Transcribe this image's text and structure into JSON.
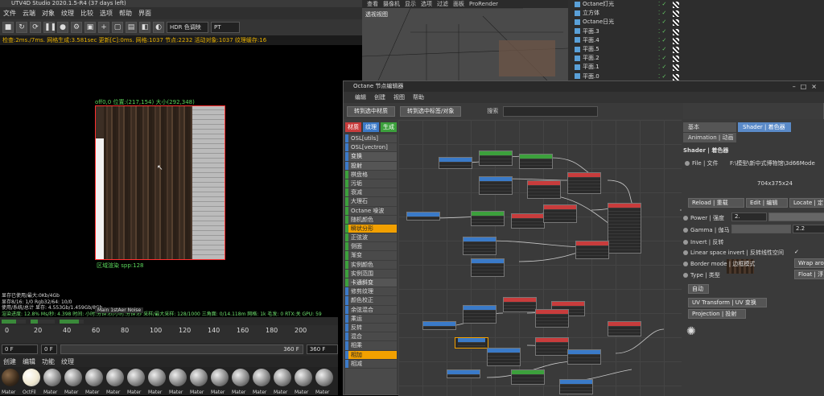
{
  "left_window": {
    "title": "UTV4D Studio 2020.1.5-R4 (37 days left)",
    "menu": [
      "文件",
      "云端",
      "对象",
      "纹理",
      "比较",
      "选项",
      "帮助",
      "界面"
    ],
    "toolbar": {
      "hdr_select": "HDR 色调映",
      "pt_select": "PT"
    },
    "stats_line": "检查:2ms./7ms. 网格生成:3.581sec 更新[C]:0ms. 网格:1037 节点:2232 活动对象:1037 纹理缓存:16",
    "region_label": "off0,0 位置:(217,154) 大小(292,348)",
    "spp_label": "区域渲染 spp:128",
    "render_stats": [
      "显存已使用/最大:0Kb/4Gb",
      "显存8/16: 1/0     Rgb32/64: 10/0",
      "使用/系统/总计 显存: 4.553Gb/1.459Gb/8Gb",
      "渲染进度: 12.8%  Ms/秒: 4.398  时间: 小时:分钟:秒/小时:分钟:秒  采样/最大采样: 128/1000  三角面: 0/14.118m  网格: 1k  毛发: 0  RTX:关  GPU: 59"
    ],
    "main_note": "Main 1stAer Noise",
    "timeline_ticks": [
      "0",
      "20",
      "40",
      "60",
      "80",
      "100",
      "120",
      "140",
      "160",
      "180",
      "200"
    ],
    "frame_start": "0 F",
    "frame_current": "0 F",
    "frame_end": "360 F",
    "frame_end2": "360 F",
    "material_menu": [
      "创建",
      "编辑",
      "功能",
      "纹理"
    ],
    "materials": [
      "Mater",
      "OctFil",
      "Mater",
      "Mater",
      "Mater",
      "Mater",
      "Mater",
      "Mater",
      "Mater",
      "Mater",
      "Mater",
      "Mater",
      "Mater",
      "Mater",
      "Mater",
      "Mater"
    ]
  },
  "viewport": {
    "menu": [
      "查看",
      "摄像机",
      "显示",
      "选项",
      "过滤",
      "面板",
      "ProRender"
    ],
    "label": "透视视图"
  },
  "object_manager": {
    "rows": [
      "Octane灯光",
      "立方体",
      "Octane日光",
      "平面.3",
      "平面.4",
      "平面.5",
      "平面.2",
      "平面.1",
      "平面.0"
    ]
  },
  "node_editor": {
    "title": "Octane 节点编辑器",
    "menu": [
      "编辑",
      "创建",
      "视图",
      "帮助"
    ],
    "buttons": {
      "to_material": "转到选中材质",
      "to_tag": "转到选中标签/对象",
      "search": "搜索"
    },
    "cat_tabs": [
      {
        "label": "材质",
        "color": "#c83c3c"
      },
      {
        "label": "纹理",
        "color": "#3c7ac8"
      },
      {
        "label": "生成",
        "color": "#3ca03c"
      },
      {
        "label": "OSL",
        "color": "#3c6ac8"
      },
      {
        "label": "映射",
        "color": "#c83c7a"
      },
      {
        "label": "其他",
        "color": "#7a4ab0"
      },
      {
        "label": "发光",
        "color": "#b03cb0"
      },
      {
        "label": "介质",
        "color": "#2aa0a0"
      },
      {
        "label": "C4D",
        "color": "#222222"
      }
    ],
    "node_list": [
      {
        "label": "OSL[utils]",
        "hd": false,
        "c": "#3c7ac8"
      },
      {
        "label": "OSL[vectron]",
        "hd": false,
        "c": "#3c7ac8"
      },
      {
        "label": "变换",
        "hd": true,
        "c": "#3c7ac8"
      },
      {
        "label": "投射",
        "hd": true,
        "c": "#3c7ac8"
      },
      {
        "label": "棋盘格",
        "hd": false,
        "c": "#3ca03c"
      },
      {
        "label": "污垢",
        "hd": false,
        "c": "#3ca03c"
      },
      {
        "label": "衰减",
        "hd": false,
        "c": "#3ca03c"
      },
      {
        "label": "大理石",
        "hd": false,
        "c": "#3ca03c"
      },
      {
        "label": "Octane 噪波",
        "hd": false,
        "c": "#3ca03c"
      },
      {
        "label": "随机颜色",
        "hd": false,
        "c": "#3ca03c"
      },
      {
        "label": "瞬状分形",
        "hd": false,
        "c": "#3ca03c",
        "act": true
      },
      {
        "label": "正弦波",
        "hd": false,
        "c": "#3ca03c"
      },
      {
        "label": "侧面",
        "hd": false,
        "c": "#3ca03c"
      },
      {
        "label": "渐变",
        "hd": false,
        "c": "#3ca03c"
      },
      {
        "label": "实例颜色",
        "hd": false,
        "c": "#3ca03c"
      },
      {
        "label": "实例范围",
        "hd": false,
        "c": "#3ca03c"
      },
      {
        "label": "卡通斜变",
        "hd": true,
        "c": "#3ca03c"
      },
      {
        "label": "修剪纹理",
        "hd": false,
        "c": "#3c7ac8"
      },
      {
        "label": "颜色校正",
        "hd": false,
        "c": "#3c7ac8"
      },
      {
        "label": "余弦混合",
        "hd": false,
        "c": "#3c7ac8"
      },
      {
        "label": "乘运",
        "hd": false,
        "c": "#3c7ac8"
      },
      {
        "label": "反转",
        "hd": false,
        "c": "#3c7ac8"
      },
      {
        "label": "混合",
        "hd": false,
        "c": "#3c7ac8"
      },
      {
        "label": "相乘",
        "hd": false,
        "c": "#3c7ac8"
      },
      {
        "label": "相加",
        "hd": false,
        "c": "#3c7ac8",
        "act": true
      },
      {
        "label": "相减",
        "hd": false,
        "c": "#3c7ac8"
      }
    ],
    "props": {
      "tab_basic": "基本",
      "tab_shader": "Shader | 着色器",
      "tab_anim": "Animation | 动画",
      "section": "Shader | 着色器",
      "file_label": "File | 文件",
      "file_path": "F:\\模型\\新中式博物馆\\3d66Mode",
      "resolution": "704x375x24",
      "reload": "Reload | 重载",
      "edit": "Edit | 编辑",
      "locate": "Locate | 定",
      "power_label": "Power | 强度",
      "power_value": "2.",
      "gamma_label": "Gamma | 伽马",
      "gamma_value": "2.2",
      "invert_label": "Invert | 反转",
      "linear_label": "Linear space invert | 反转线性空间",
      "linear_check": "✓",
      "border_label": "Border mode | 边框模式",
      "border_value": "Wrap aro",
      "type_label": "Type | 类型",
      "type_value": "Float | 浮",
      "auto_btn": "自动",
      "uv_btn": "UV Transform | UV 变换",
      "proj_btn": "Projection | 投射"
    }
  }
}
